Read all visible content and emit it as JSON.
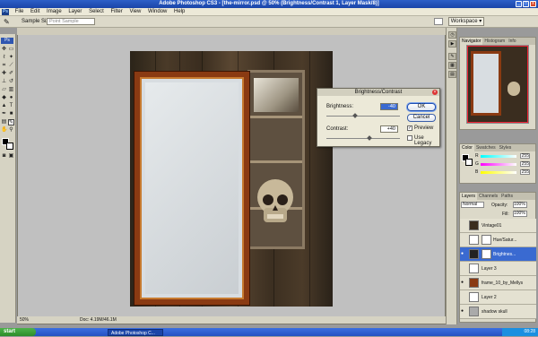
{
  "titlebar": {
    "title": "Adobe Photoshop CS3 - [the-mirror.psd @ 50% (Brightness/Contrast 1, Layer Mask/8)]",
    "min": "_",
    "max": "□",
    "close": "x"
  },
  "menu": {
    "items": [
      "File",
      "Edit",
      "Image",
      "Layer",
      "Select",
      "Filter",
      "View",
      "Window",
      "Help"
    ],
    "ps_badge": "Ps"
  },
  "options": {
    "sample_size_label": "Sample Size:",
    "sample_size_value": "Point Sample",
    "workspace": "Workspace ▾"
  },
  "document": {
    "status": "50%",
    "doc_info": "Doc: 4.19M/46.1M"
  },
  "dialog": {
    "title": "Brightness/Contrast",
    "brightness_label": "Brightness:",
    "brightness_value": "-40",
    "contrast_label": "Contrast:",
    "contrast_value": "+40",
    "ok": "OK",
    "cancel": "Cancel",
    "preview_label": "Preview",
    "legacy_label": "Use Legacy",
    "preview_checked": true,
    "legacy_checked": false
  },
  "navigator": {
    "tabs": [
      "Navigator",
      "Histogram",
      "Info"
    ]
  },
  "color": {
    "tabs": [
      "Color",
      "Swatches",
      "Styles"
    ],
    "r_label": "R",
    "g_label": "G",
    "b_label": "B",
    "r_value": "255",
    "g_value": "255",
    "b_value": "255"
  },
  "layers": {
    "tabs": [
      "Layers",
      "Channels",
      "Paths"
    ],
    "blend_mode": "Normal",
    "opacity_label": "Opacity:",
    "opacity_value": "100%",
    "fill_label": "Fill:",
    "fill_value": "100%",
    "rows": [
      {
        "name": "Vintage01",
        "visible": false,
        "selected": false
      },
      {
        "name": "Hue/Satur...",
        "visible": false,
        "selected": false
      },
      {
        "name": "Brightnes...",
        "visible": true,
        "selected": true
      },
      {
        "name": "Layer 3",
        "visible": false,
        "selected": false
      },
      {
        "name": "frame_10_by_Mellys",
        "visible": true,
        "selected": false
      },
      {
        "name": "Layer 2",
        "visible": false,
        "selected": false
      },
      {
        "name": "shadow skull",
        "visible": true,
        "selected": false
      }
    ]
  },
  "taskbar": {
    "start": "start",
    "item": "Adobe Photoshop C...",
    "clock": "08:28"
  }
}
